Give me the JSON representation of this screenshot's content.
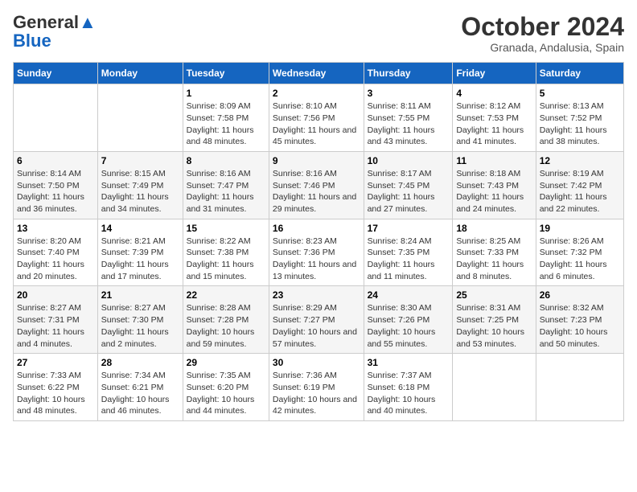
{
  "logo": {
    "line1": "General",
    "line2": "Blue"
  },
  "title": "October 2024",
  "subtitle": "Granada, Andalusia, Spain",
  "days_of_week": [
    "Sunday",
    "Monday",
    "Tuesday",
    "Wednesday",
    "Thursday",
    "Friday",
    "Saturday"
  ],
  "weeks": [
    [
      {
        "day": "",
        "info": ""
      },
      {
        "day": "",
        "info": ""
      },
      {
        "day": "1",
        "info": "Sunrise: 8:09 AM\nSunset: 7:58 PM\nDaylight: 11 hours and 48 minutes."
      },
      {
        "day": "2",
        "info": "Sunrise: 8:10 AM\nSunset: 7:56 PM\nDaylight: 11 hours and 45 minutes."
      },
      {
        "day": "3",
        "info": "Sunrise: 8:11 AM\nSunset: 7:55 PM\nDaylight: 11 hours and 43 minutes."
      },
      {
        "day": "4",
        "info": "Sunrise: 8:12 AM\nSunset: 7:53 PM\nDaylight: 11 hours and 41 minutes."
      },
      {
        "day": "5",
        "info": "Sunrise: 8:13 AM\nSunset: 7:52 PM\nDaylight: 11 hours and 38 minutes."
      }
    ],
    [
      {
        "day": "6",
        "info": "Sunrise: 8:14 AM\nSunset: 7:50 PM\nDaylight: 11 hours and 36 minutes."
      },
      {
        "day": "7",
        "info": "Sunrise: 8:15 AM\nSunset: 7:49 PM\nDaylight: 11 hours and 34 minutes."
      },
      {
        "day": "8",
        "info": "Sunrise: 8:16 AM\nSunset: 7:47 PM\nDaylight: 11 hours and 31 minutes."
      },
      {
        "day": "9",
        "info": "Sunrise: 8:16 AM\nSunset: 7:46 PM\nDaylight: 11 hours and 29 minutes."
      },
      {
        "day": "10",
        "info": "Sunrise: 8:17 AM\nSunset: 7:45 PM\nDaylight: 11 hours and 27 minutes."
      },
      {
        "day": "11",
        "info": "Sunrise: 8:18 AM\nSunset: 7:43 PM\nDaylight: 11 hours and 24 minutes."
      },
      {
        "day": "12",
        "info": "Sunrise: 8:19 AM\nSunset: 7:42 PM\nDaylight: 11 hours and 22 minutes."
      }
    ],
    [
      {
        "day": "13",
        "info": "Sunrise: 8:20 AM\nSunset: 7:40 PM\nDaylight: 11 hours and 20 minutes."
      },
      {
        "day": "14",
        "info": "Sunrise: 8:21 AM\nSunset: 7:39 PM\nDaylight: 11 hours and 17 minutes."
      },
      {
        "day": "15",
        "info": "Sunrise: 8:22 AM\nSunset: 7:38 PM\nDaylight: 11 hours and 15 minutes."
      },
      {
        "day": "16",
        "info": "Sunrise: 8:23 AM\nSunset: 7:36 PM\nDaylight: 11 hours and 13 minutes."
      },
      {
        "day": "17",
        "info": "Sunrise: 8:24 AM\nSunset: 7:35 PM\nDaylight: 11 hours and 11 minutes."
      },
      {
        "day": "18",
        "info": "Sunrise: 8:25 AM\nSunset: 7:33 PM\nDaylight: 11 hours and 8 minutes."
      },
      {
        "day": "19",
        "info": "Sunrise: 8:26 AM\nSunset: 7:32 PM\nDaylight: 11 hours and 6 minutes."
      }
    ],
    [
      {
        "day": "20",
        "info": "Sunrise: 8:27 AM\nSunset: 7:31 PM\nDaylight: 11 hours and 4 minutes."
      },
      {
        "day": "21",
        "info": "Sunrise: 8:27 AM\nSunset: 7:30 PM\nDaylight: 11 hours and 2 minutes."
      },
      {
        "day": "22",
        "info": "Sunrise: 8:28 AM\nSunset: 7:28 PM\nDaylight: 10 hours and 59 minutes."
      },
      {
        "day": "23",
        "info": "Sunrise: 8:29 AM\nSunset: 7:27 PM\nDaylight: 10 hours and 57 minutes."
      },
      {
        "day": "24",
        "info": "Sunrise: 8:30 AM\nSunset: 7:26 PM\nDaylight: 10 hours and 55 minutes."
      },
      {
        "day": "25",
        "info": "Sunrise: 8:31 AM\nSunset: 7:25 PM\nDaylight: 10 hours and 53 minutes."
      },
      {
        "day": "26",
        "info": "Sunrise: 8:32 AM\nSunset: 7:23 PM\nDaylight: 10 hours and 50 minutes."
      }
    ],
    [
      {
        "day": "27",
        "info": "Sunrise: 7:33 AM\nSunset: 6:22 PM\nDaylight: 10 hours and 48 minutes."
      },
      {
        "day": "28",
        "info": "Sunrise: 7:34 AM\nSunset: 6:21 PM\nDaylight: 10 hours and 46 minutes."
      },
      {
        "day": "29",
        "info": "Sunrise: 7:35 AM\nSunset: 6:20 PM\nDaylight: 10 hours and 44 minutes."
      },
      {
        "day": "30",
        "info": "Sunrise: 7:36 AM\nSunset: 6:19 PM\nDaylight: 10 hours and 42 minutes."
      },
      {
        "day": "31",
        "info": "Sunrise: 7:37 AM\nSunset: 6:18 PM\nDaylight: 10 hours and 40 minutes."
      },
      {
        "day": "",
        "info": ""
      },
      {
        "day": "",
        "info": ""
      }
    ]
  ]
}
